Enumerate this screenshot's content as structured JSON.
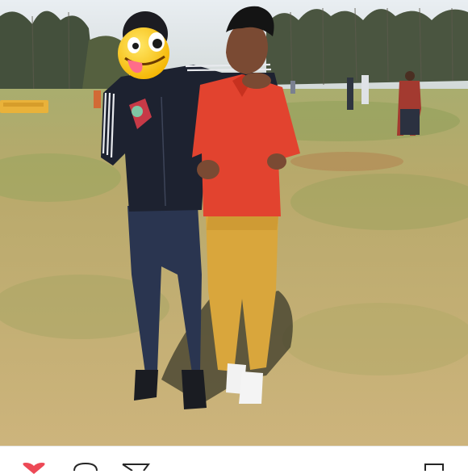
{
  "post": {
    "photo": {
      "kind": "photo",
      "sticker_icon": "tongue-out-winking-face-emoji",
      "colors": {
        "sky": "#dfe6ec",
        "trees": "#3f4a38",
        "field_dry": "#c9b57e",
        "field_green": "#8ea25c",
        "red_shirt": "#e2432f",
        "khaki_pants": "#d9a63c",
        "jacket": "#1d2230",
        "jeans": "#2a3550",
        "skin": "#7a4a33",
        "shadow": "#3b3a2a",
        "bus": "#e9b23a"
      }
    },
    "actions": {
      "like_icon": "heart-icon",
      "like_color": "#ed4956",
      "comment_icon": "comment-icon",
      "share_icon": "send-icon",
      "save_icon": "bookmark-icon"
    }
  }
}
